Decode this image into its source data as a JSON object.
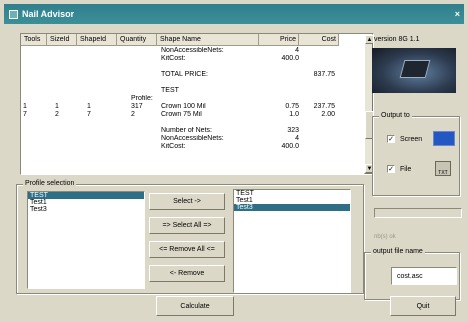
{
  "window": {
    "title": "Nail Advisor",
    "close_glyph": "×"
  },
  "results": {
    "columns": [
      "Tools",
      "SizeId",
      "ShapeId",
      "Quantity",
      "Shape Name",
      "Price",
      "Cost"
    ],
    "rows": [
      [
        "",
        "",
        "",
        "",
        "NonAccessibleNets:",
        "4",
        ""
      ],
      [
        "",
        "",
        "",
        "",
        "KitCost:",
        "400.0",
        ""
      ],
      [
        "",
        "",
        "",
        "",
        "",
        "",
        ""
      ],
      [
        "",
        "",
        "",
        "",
        "TOTAL PRICE:",
        "",
        "837.75"
      ],
      [
        "",
        "",
        "",
        "",
        "",
        "",
        ""
      ],
      [
        "",
        "",
        "",
        "",
        "TEST",
        "",
        ""
      ],
      [
        "",
        "",
        "",
        "Profile:",
        "",
        "",
        ""
      ],
      [
        "1",
        "1",
        "1",
        "317",
        "Crown 100 Mil",
        "0.75",
        "237.75"
      ],
      [
        "7",
        "2",
        "7",
        "2",
        "Crown 75 Mil",
        "1.0",
        "2.00"
      ],
      [
        "",
        "",
        "",
        "",
        "",
        "",
        ""
      ],
      [
        "",
        "",
        "",
        "",
        "Number of Nets:",
        "323",
        ""
      ],
      [
        "",
        "",
        "",
        "",
        "NonAccessibleNets:",
        "4",
        ""
      ],
      [
        "",
        "",
        "",
        "",
        "KitCost:",
        "400.0",
        ""
      ]
    ]
  },
  "version_label": "version 8G 1.1",
  "output_to": {
    "label": "Output to",
    "screen_label": "Screen",
    "file_label": "File",
    "file_icon_text": "TXT"
  },
  "profile_selection": {
    "label": "Profile selection",
    "available": [
      "TEST",
      "Test1",
      "Test3"
    ],
    "selected": [
      "TEST",
      "Test1",
      "Test3"
    ]
  },
  "buttons": {
    "select": "Select ->",
    "select_all": "=> Select All =>",
    "remove_all": "<= Remove All <=",
    "remove": "<- Remove",
    "calculate": "Calculate",
    "quit": "Quit"
  },
  "faded_text": "nb(s) ok",
  "output_file": {
    "label": "output file name",
    "value": "cost.asc"
  }
}
